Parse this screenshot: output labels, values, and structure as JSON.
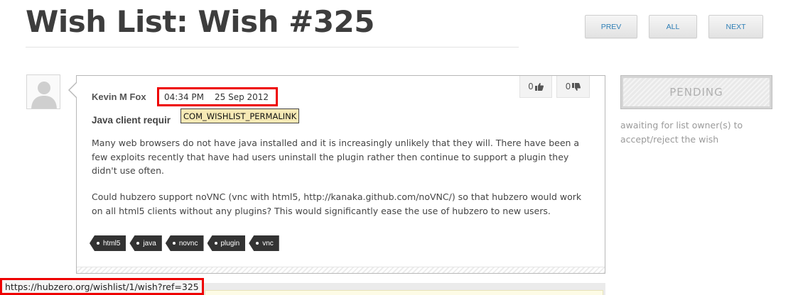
{
  "page": {
    "title": "Wish List: Wish #325"
  },
  "nav": {
    "prev_label": "PREV",
    "all_label": "ALL",
    "next_label": "NEXT"
  },
  "wish": {
    "author": "Kevin M Fox",
    "time": "04:34 PM",
    "date": "25 Sep 2012",
    "subject_visible": "Java client requir",
    "tooltip": "COM_WISHLIST_PERMALINK",
    "paragraphs": [
      "Many web browsers do not have java installed and it is increasingly unlikely that they will. There have been a few exploits recently that have had users uninstall the plugin rather then continue to support a plugin they didn't use often.",
      "Could hubzero support noVNC (vnc with html5, http://kanaka.github.com/noVNC/) so that hubzero would work on all html5 clients without any plugins? This would significantly ease the use of hubzero to new users."
    ],
    "votes": {
      "up": "0",
      "down": "0",
      "up_icon": "thumbs-up-icon",
      "down_icon": "thumbs-down-icon"
    },
    "tags": [
      "html5",
      "java",
      "novnc",
      "plugin",
      "vnc"
    ]
  },
  "status": {
    "label": "PENDING",
    "note": "awaiting for list owner(s) to accept/reject the wish"
  },
  "browser": {
    "status_url": "https://hubzero.org/wishlist/1/wish?ref=325"
  },
  "colors": {
    "link_blue": "#2f7fb6",
    "highlight_red": "#ee0000",
    "tooltip_bg": "#f6e9b5",
    "tag_bg": "#333333"
  }
}
